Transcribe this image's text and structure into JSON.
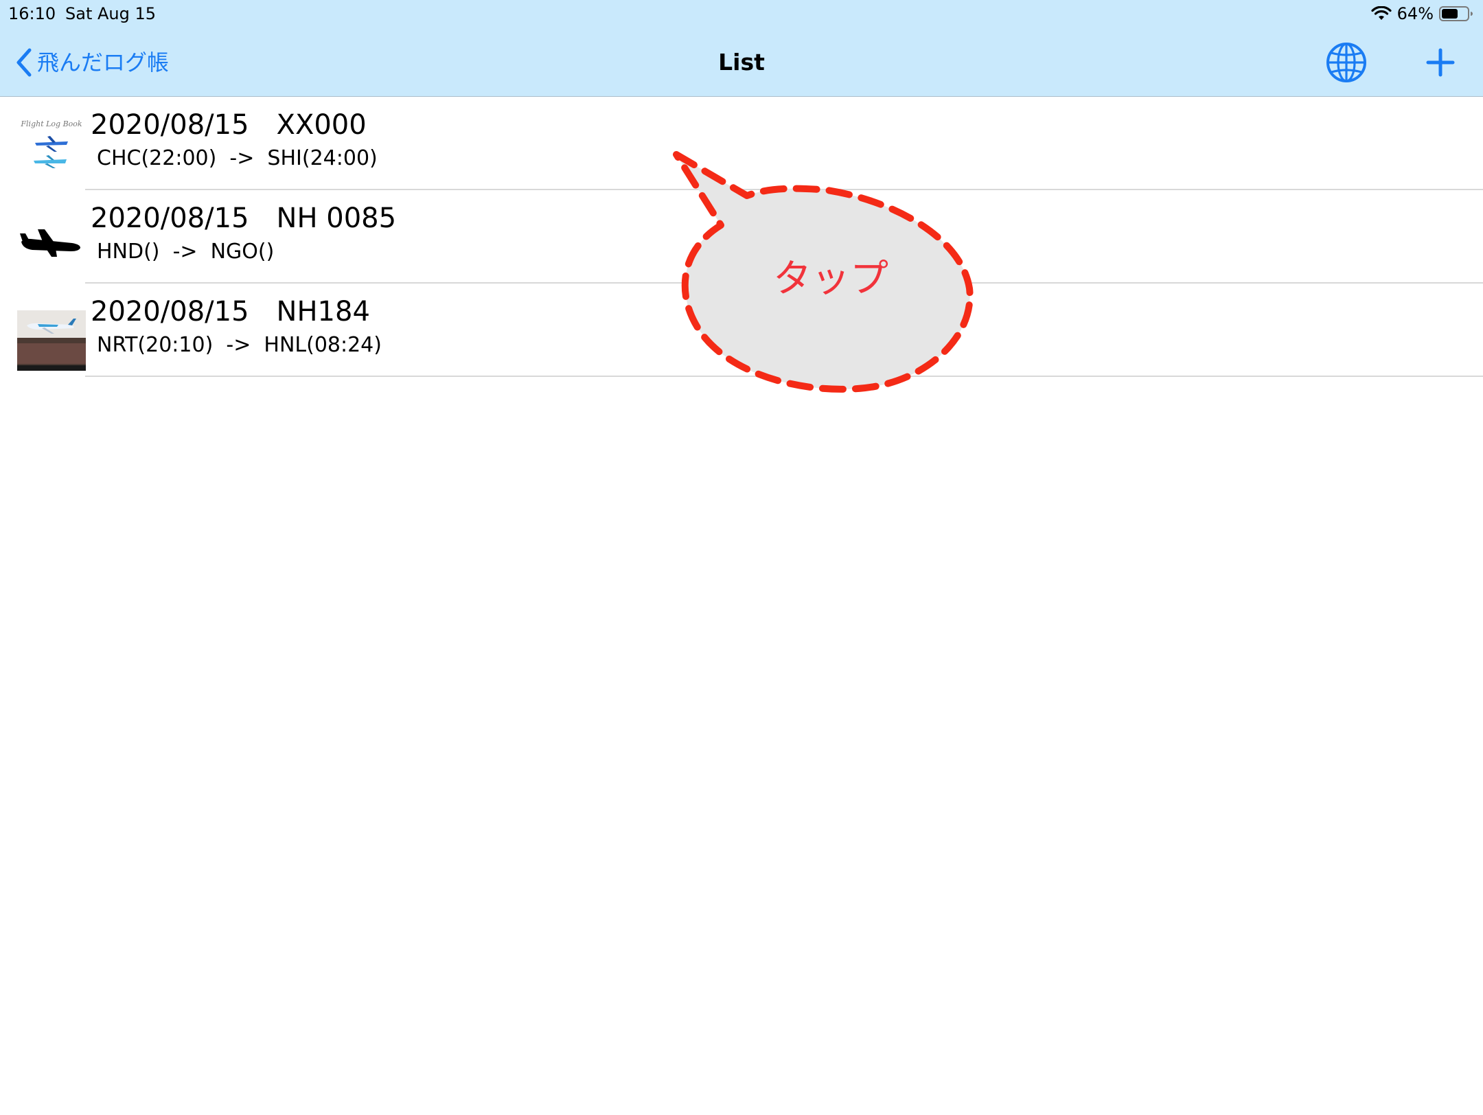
{
  "status_bar": {
    "time": "16:10",
    "date": "Sat Aug 15",
    "battery_percent": "64%",
    "battery_level": 0.64,
    "wifi_icon": "wifi-icon",
    "battery_icon": "battery-icon"
  },
  "nav": {
    "back_label": "飛んだログ帳",
    "back_icon": "chevron-left-icon",
    "title": "List",
    "globe_icon": "globe-icon",
    "add_icon": "plus-icon",
    "accent_color": "#1a7cf3",
    "background_color": "#c9e9fc"
  },
  "flights": [
    {
      "title": "2020/08/15　XX000",
      "route": "CHC(22:00)  ->  SHI(24:00)",
      "thumbnail": "flight-log-logo-thumbnail"
    },
    {
      "title": "2020/08/15　NH 0085",
      "route": "HND()  ->  NGO()",
      "thumbnail": "airplane-silhouette-thumbnail"
    },
    {
      "title": "2020/08/15　NH184",
      "route": "NRT(20:10)  ->  HNL(08:24)",
      "thumbnail": "a380-photo-thumbnail"
    }
  ],
  "callout": {
    "label": "タップ",
    "stroke_color": "#f42a16",
    "fill_color": "#e6e6e6",
    "text_color": "#f1333b"
  }
}
